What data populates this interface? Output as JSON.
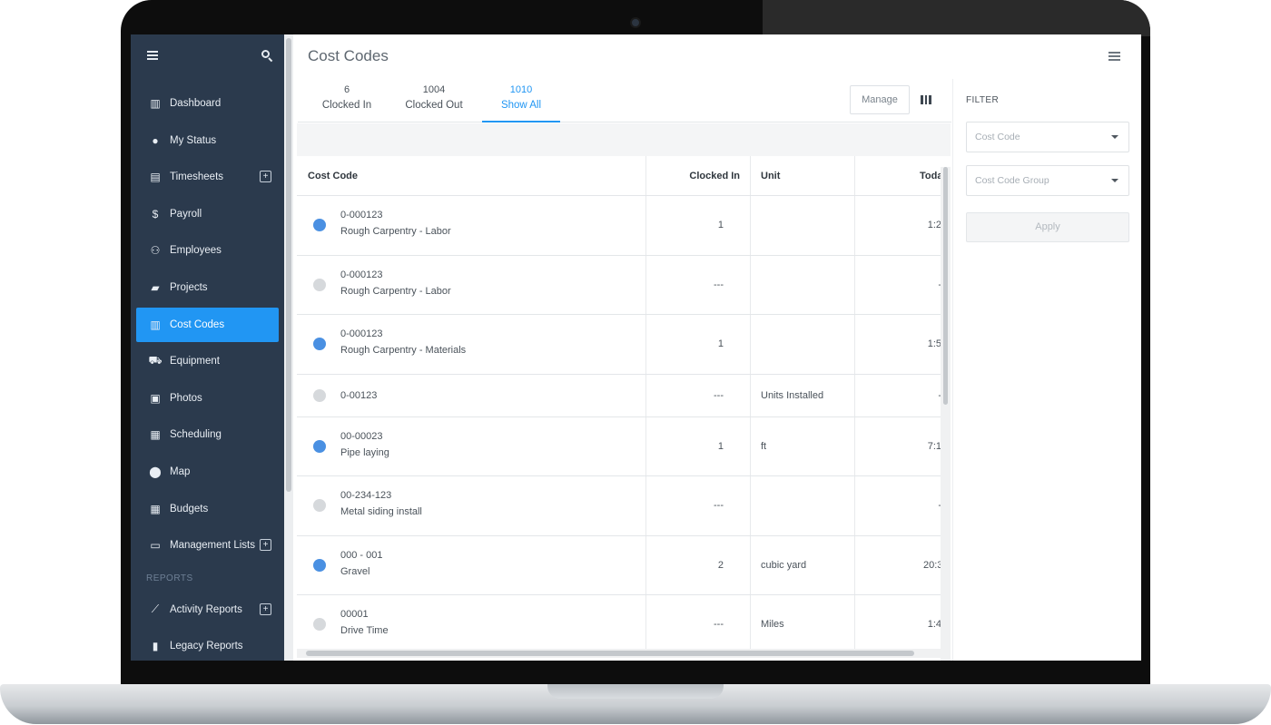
{
  "sidebar": {
    "items": [
      {
        "label": "Dashboard",
        "icon": "dashboard-icon",
        "plus": false
      },
      {
        "label": "My Status",
        "icon": "person-icon",
        "plus": false
      },
      {
        "label": "Timesheets",
        "icon": "timesheet-icon",
        "plus": true
      },
      {
        "label": "Payroll",
        "icon": "dollar-icon",
        "plus": false
      },
      {
        "label": "Employees",
        "icon": "people-icon",
        "plus": false
      },
      {
        "label": "Projects",
        "icon": "folder-icon",
        "plus": false
      },
      {
        "label": "Cost Codes",
        "icon": "barcode-icon",
        "plus": false,
        "active": true
      },
      {
        "label": "Equipment",
        "icon": "equipment-icon",
        "plus": false
      },
      {
        "label": "Photos",
        "icon": "photos-icon",
        "plus": false
      },
      {
        "label": "Scheduling",
        "icon": "calendar-icon",
        "plus": false
      },
      {
        "label": "Map",
        "icon": "map-pin-icon",
        "plus": false
      },
      {
        "label": "Budgets",
        "icon": "calculator-icon",
        "plus": false
      },
      {
        "label": "Management Lists",
        "icon": "clipboard-icon",
        "plus": true
      }
    ],
    "reports_heading": "REPORTS",
    "report_items": [
      {
        "label": "Activity Reports",
        "icon": "activity-chart-icon",
        "plus": true
      },
      {
        "label": "Legacy Reports",
        "icon": "bar-chart-icon",
        "plus": false
      }
    ],
    "plus_symbol": "+"
  },
  "header": {
    "title": "Cost Codes"
  },
  "tabs": [
    {
      "count": "6",
      "label": "Clocked In"
    },
    {
      "count": "1004",
      "label": "Clocked Out"
    },
    {
      "count": "1010",
      "label": "Show All",
      "active": true
    }
  ],
  "toolbar": {
    "manage_label": "Manage"
  },
  "table": {
    "columns": {
      "cost_code": "Cost Code",
      "clocked_in": "Clocked In",
      "unit": "Unit",
      "today": "Today"
    },
    "rows": [
      {
        "status": "blue",
        "code": "0-000123",
        "name": "Rough Carpentry - Labor",
        "clocked_in": "1",
        "unit": "",
        "today": "1:2"
      },
      {
        "status": "gray",
        "code": "0-000123",
        "name": "Rough Carpentry - Labor",
        "clocked_in": "---",
        "unit": "",
        "today": "-"
      },
      {
        "status": "blue",
        "code": "0-000123",
        "name": "Rough Carpentry - Materials",
        "clocked_in": "1",
        "unit": "",
        "today": "1:5"
      },
      {
        "status": "gray",
        "code": "0-00123",
        "name": "",
        "clocked_in": "---",
        "unit": "Units Installed",
        "today": "-"
      },
      {
        "status": "blue",
        "code": "00-00023",
        "name": "Pipe laying",
        "clocked_in": "1",
        "unit": "ft",
        "today": "7:1"
      },
      {
        "status": "gray",
        "code": "00-234-123",
        "name": "Metal siding install",
        "clocked_in": "---",
        "unit": "",
        "today": "-"
      },
      {
        "status": "blue",
        "code": "000 - 001",
        "name": "Gravel",
        "clocked_in": "2",
        "unit": "cubic yard",
        "today": "20:3"
      },
      {
        "status": "gray",
        "code": "00001",
        "name": "Drive Time",
        "clocked_in": "---",
        "unit": "Miles",
        "today": "1:4"
      }
    ]
  },
  "filter": {
    "title": "FILTER",
    "cost_code_placeholder": "Cost Code",
    "cost_code_group_placeholder": "Cost Code Group",
    "apply_label": "Apply"
  },
  "colors": {
    "sidebar_bg": "#2b3a4d",
    "accent": "#2196f3",
    "status_active": "#4a90e2",
    "status_inactive": "#d6d9dc"
  }
}
